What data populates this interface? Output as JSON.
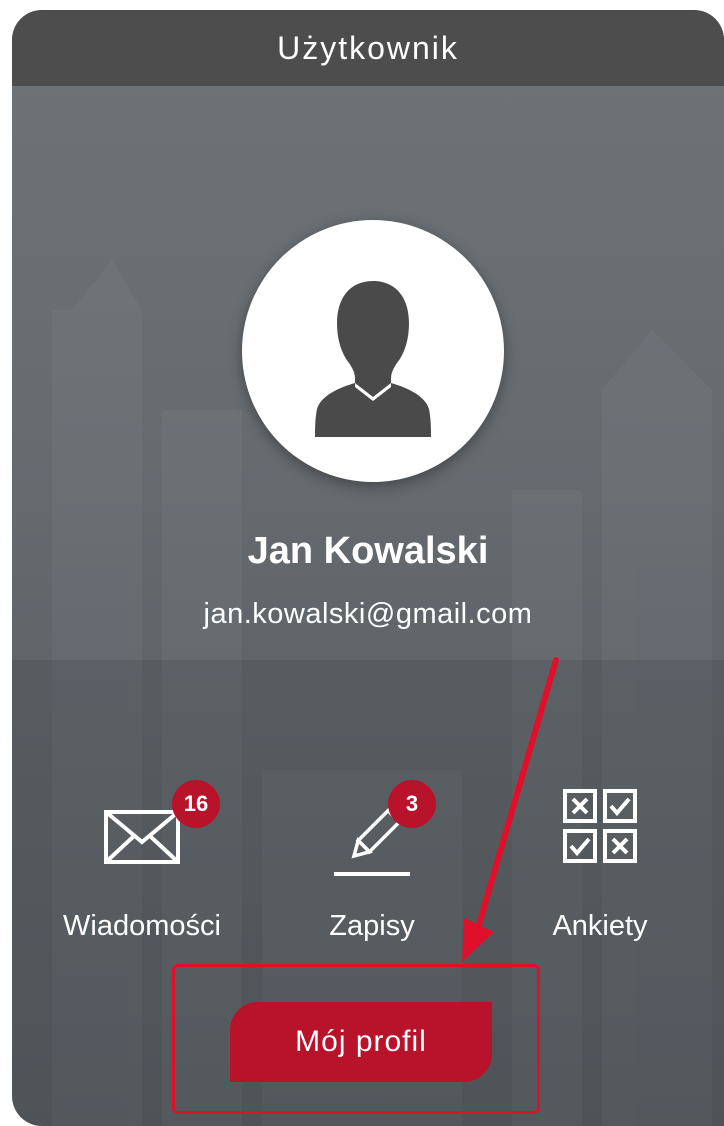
{
  "card": {
    "title": "Użytkownik"
  },
  "user": {
    "name": "Jan Kowalski",
    "email": "jan.kowalski@gmail.com",
    "avatar_icon": "user-silhouette-icon"
  },
  "actions": [
    {
      "label": "Wiadomości",
      "icon": "envelope-icon",
      "badge": "16"
    },
    {
      "label": "Zapisy",
      "icon": "pencil-sign-icon",
      "badge": "3"
    },
    {
      "label": "Ankiety",
      "icon": "survey-checkbox-grid-icon",
      "badge": ""
    }
  ],
  "profile_button": {
    "label": "Mój profil"
  },
  "colors": {
    "header_bg": "#4d4d4d",
    "accent": "#b8132b",
    "highlight": "#e0102a",
    "card_bg": "#666b70"
  }
}
